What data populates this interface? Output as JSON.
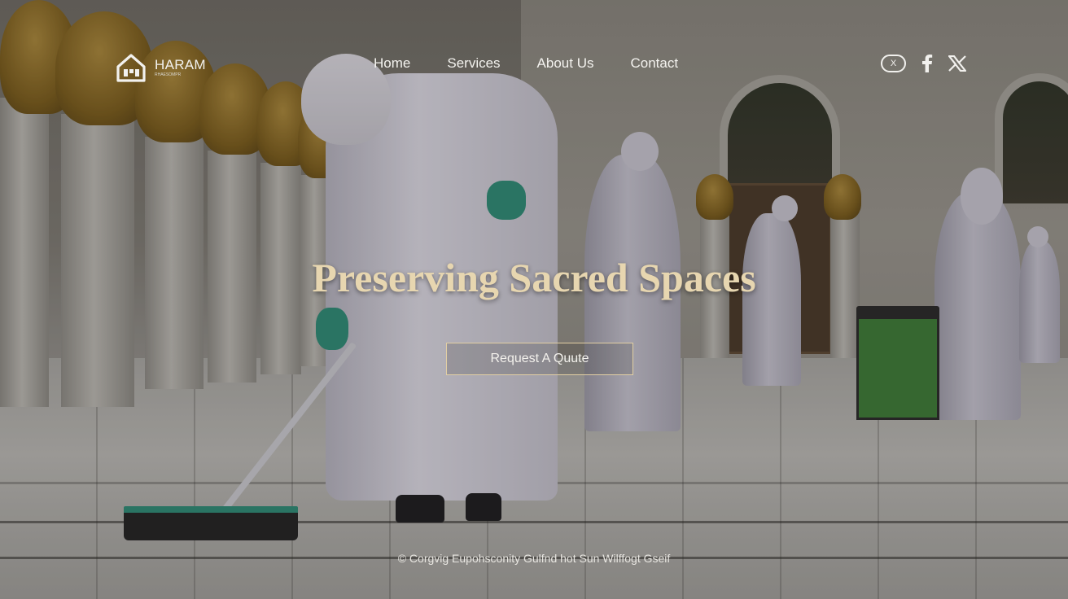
{
  "brand": {
    "name": "HARAM",
    "tagline": "RHAESOMPR"
  },
  "nav": {
    "items": [
      "Home",
      "Services",
      "About Us",
      "Contact"
    ]
  },
  "social": {
    "icons": [
      "x-badge-icon",
      "facebook-icon",
      "x-icon"
    ],
    "x_badge_text": "X"
  },
  "hero": {
    "headline": "Preserving Sacred Spaces",
    "cta_label": "Request A Quute"
  },
  "footer": {
    "text": "© Corgvig Eupohsconity Gulfnd hot Sun Wilffogt Gseif"
  },
  "colors": {
    "headline": "#e7d6b0",
    "cta_border": "#e2cfa4",
    "accent_green": "#2f8a76"
  }
}
